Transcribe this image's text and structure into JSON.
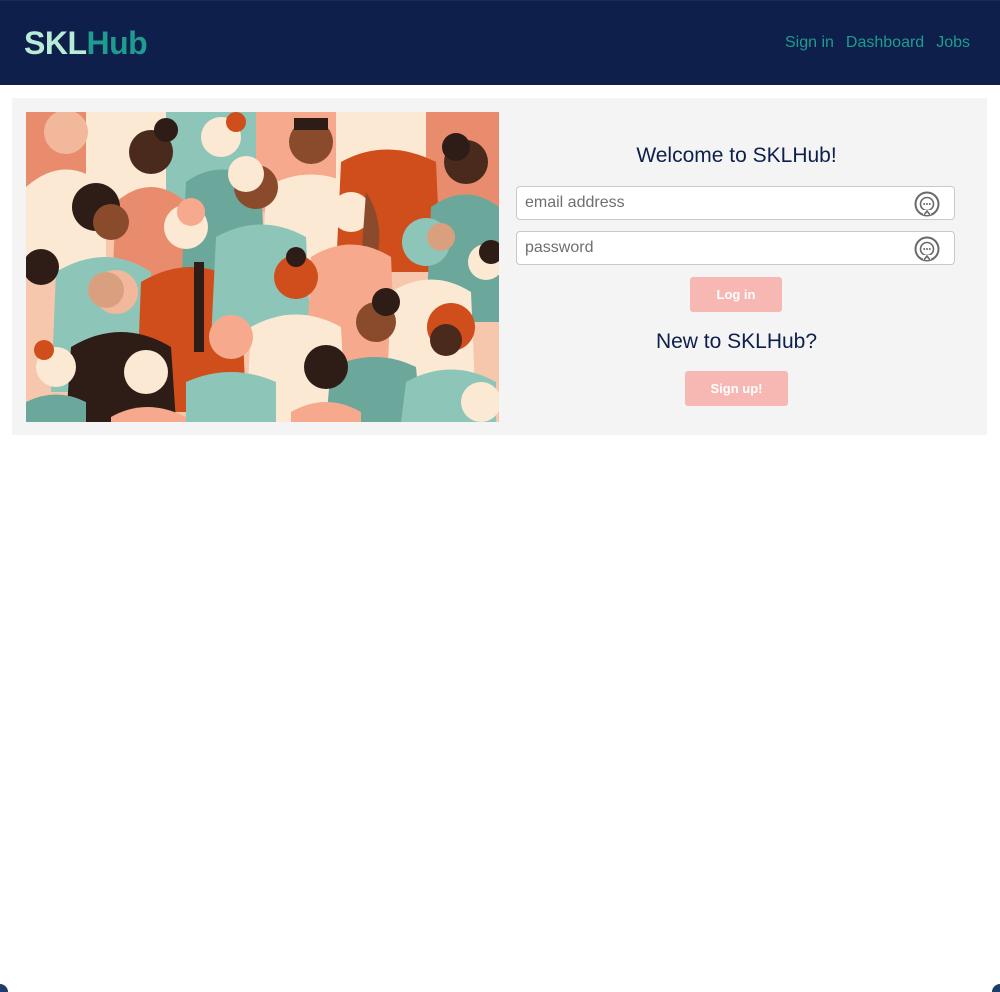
{
  "brand": {
    "part1": "SKL",
    "part2": "Hub",
    "color1": "#b9ecd6",
    "color2": "#1e9c8f"
  },
  "nav": {
    "links": [
      "Sign in",
      "Dashboard",
      "Jobs"
    ],
    "bg": "#0d1f4a"
  },
  "login": {
    "title": "Welcome to SKLHub!",
    "email_placeholder": "email address",
    "password_placeholder": "password",
    "login_label": "Log in",
    "new_title": "New to SKLHub?",
    "signup_label": "Sign up!",
    "button_color": "#f7b7b3",
    "field_icon": "password-manager-keypad-icon"
  },
  "hero": {
    "icon": "diverse-crowd-illustration"
  }
}
